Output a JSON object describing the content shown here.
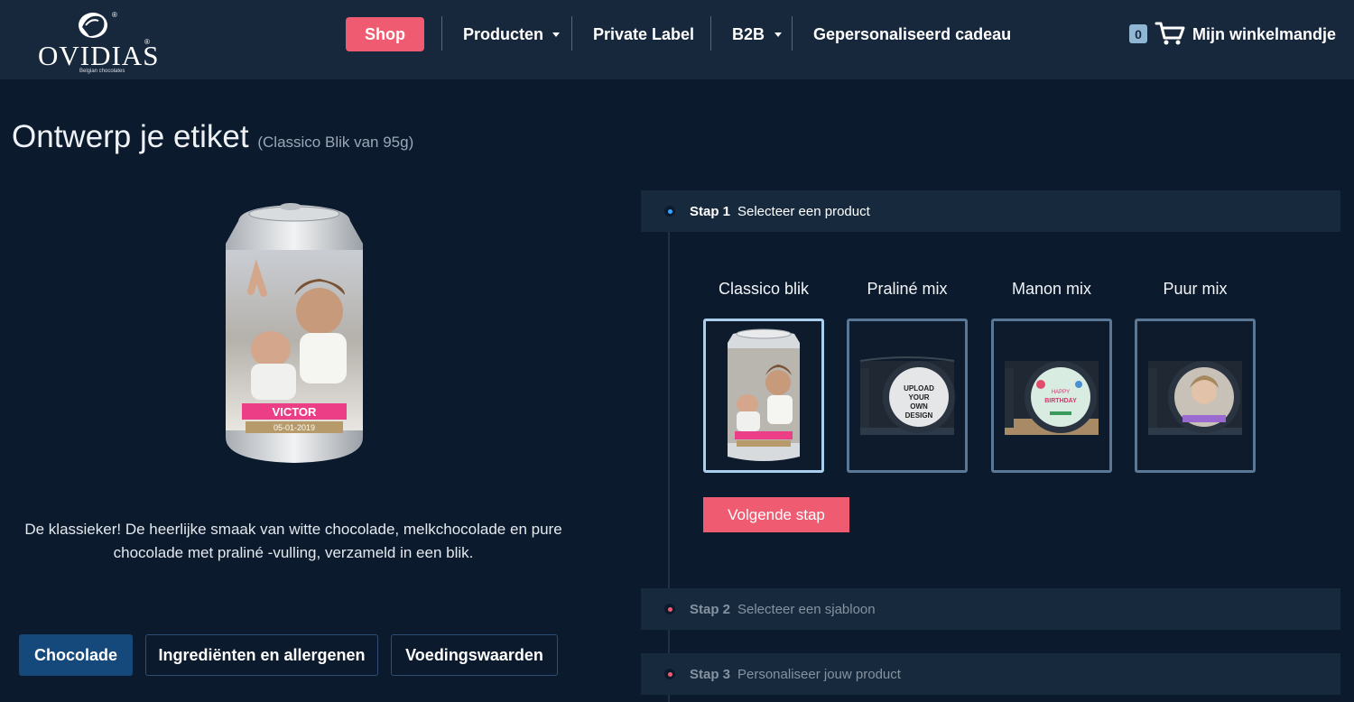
{
  "brand": {
    "name": "OVIDIAS",
    "tagline": "Belgian chocolates"
  },
  "nav": {
    "shop": "Shop",
    "producten": "Producten",
    "private_label": "Private Label",
    "b2b": "B2B",
    "gepersonaliseerd": "Gepersonaliseerd cadeau",
    "cart_count": "0",
    "cart_label": "Mijn winkelmandje"
  },
  "page": {
    "title": "Ontwerp je etiket",
    "subtitle": "(Classico Blik van 95g)",
    "can_name": "VICTOR",
    "can_date": "05-01-2019",
    "description": "De klassieker! De heerlijke smaak van witte chocolade, melkchocolade en pure chocolade met praliné -vulling, verzameld in een blik."
  },
  "tabs": [
    "Chocolade",
    "Ingrediënten en allergenen",
    "Voedingswaarden"
  ],
  "steps": [
    {
      "num": "Stap 1",
      "label": "Selecteer een product",
      "state": "active"
    },
    {
      "num": "Stap 2",
      "label": "Selecteer een sjabloon",
      "state": "inactive"
    },
    {
      "num": "Stap 3",
      "label": "Personaliseer jouw product",
      "state": "inactive"
    }
  ],
  "products": [
    {
      "label": "Classico blik",
      "selected": true
    },
    {
      "label": "Praliné mix",
      "selected": false,
      "lid_text": [
        "UPLOAD",
        "YOUR",
        "OWN",
        "DESIGN"
      ]
    },
    {
      "label": "Manon mix",
      "selected": false,
      "lid_text": [
        "HAPPY",
        "BIRTHDAY"
      ]
    },
    {
      "label": "Puur mix",
      "selected": false
    }
  ],
  "next_button": "Volgende stap",
  "colors": {
    "accent": "#ef5b71",
    "header": "#17283c",
    "background": "#0b1a2d",
    "tab_active": "#16497b",
    "step_dot_active": "#3aa3ff",
    "step_dot_inactive": "#ef5b71"
  }
}
